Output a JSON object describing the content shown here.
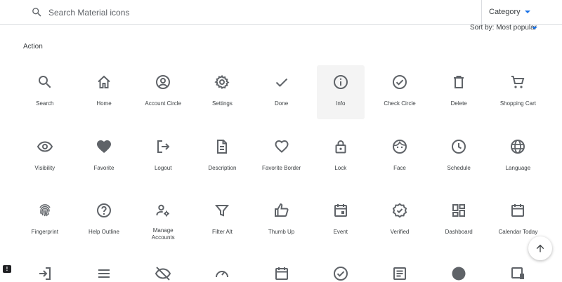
{
  "search": {
    "placeholder": "Search Material icons"
  },
  "category": {
    "label": "Category"
  },
  "sort": {
    "label": "Sort by: Most popular"
  },
  "section": {
    "title": "Action"
  },
  "icons": [
    {
      "label": "Search",
      "icon": "search-icon"
    },
    {
      "label": "Home",
      "icon": "home-icon"
    },
    {
      "label": "Account Circle",
      "icon": "account-circle-icon"
    },
    {
      "label": "Settings",
      "icon": "settings-icon"
    },
    {
      "label": "Done",
      "icon": "done-icon"
    },
    {
      "label": "Info",
      "icon": "info-icon",
      "selected": true
    },
    {
      "label": "Check Circle",
      "icon": "check-circle-icon"
    },
    {
      "label": "Delete",
      "icon": "delete-icon"
    },
    {
      "label": "Shopping Cart",
      "icon": "shopping-cart-icon"
    },
    {
      "label": "Visibility",
      "icon": "visibility-icon"
    },
    {
      "label": "Favorite",
      "icon": "favorite-icon"
    },
    {
      "label": "Logout",
      "icon": "logout-icon"
    },
    {
      "label": "Description",
      "icon": "description-icon"
    },
    {
      "label": "Favorite Border",
      "icon": "favorite-border-icon"
    },
    {
      "label": "Lock",
      "icon": "lock-icon"
    },
    {
      "label": "Face",
      "icon": "face-icon"
    },
    {
      "label": "Schedule",
      "icon": "schedule-icon"
    },
    {
      "label": "Language",
      "icon": "language-icon"
    },
    {
      "label": "Fingerprint",
      "icon": "fingerprint-icon"
    },
    {
      "label": "Help Outline",
      "icon": "help-outline-icon"
    },
    {
      "label": "Manage Accounts",
      "icon": "manage-accounts-icon"
    },
    {
      "label": "Filter Alt",
      "icon": "filter-alt-icon"
    },
    {
      "label": "Thumb Up",
      "icon": "thumb-up-icon"
    },
    {
      "label": "Event",
      "icon": "event-icon"
    },
    {
      "label": "Verified",
      "icon": "verified-icon"
    },
    {
      "label": "Dashboard",
      "icon": "dashboard-icon"
    },
    {
      "label": "Calendar Today",
      "icon": "calendar-today-icon"
    }
  ],
  "partial_icons": [
    "login-icon",
    "list-icon",
    "visibility-off-icon",
    "speed-icon",
    "calendar-month-icon",
    "check-circle-outline-icon",
    "article-icon",
    "help-icon",
    "preview-icon"
  ],
  "colors": {
    "icon": "#5f6368",
    "accent": "#1a73e8",
    "selected_bg": "#f4f4f4"
  }
}
